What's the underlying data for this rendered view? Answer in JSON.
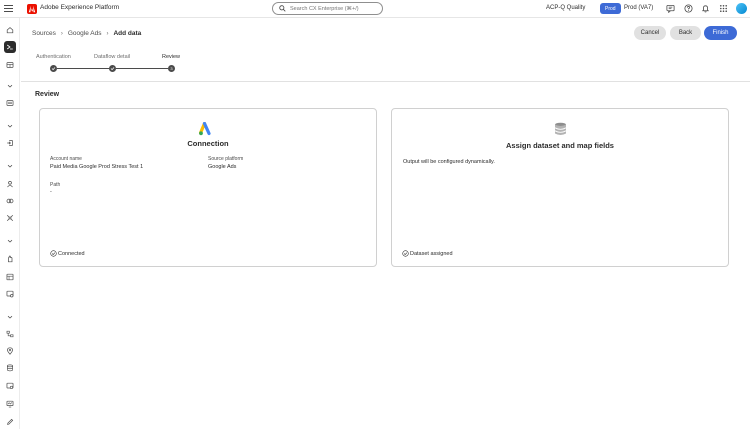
{
  "header": {
    "app_title": "Adobe Experience Platform",
    "search_placeholder": "Search CX Enterprise (⌘+/)",
    "org_name": "ACP-Q Quality",
    "env_badge": "Prod",
    "sandbox_name": "Prod (VA7)",
    "icons": [
      "feedback-icon",
      "help-icon",
      "notifications-icon",
      "app-switcher-icon",
      "avatar"
    ]
  },
  "sidebar": {
    "items": [
      {
        "icon": "home-icon",
        "active": false
      },
      {
        "icon": "sources-icon",
        "active": true
      },
      {
        "icon": "browse-icon",
        "active": false
      },
      {
        "icon": "chevron-down-icon",
        "active": false
      },
      {
        "icon": "dashboard-icon",
        "active": false
      },
      {
        "icon": "chevron-down-icon",
        "active": false
      },
      {
        "icon": "login-icon",
        "active": false
      },
      {
        "icon": "chevron-down-icon",
        "active": false
      },
      {
        "icon": "profile-icon",
        "active": false
      },
      {
        "icon": "audiences-icon",
        "active": false
      },
      {
        "icon": "identities-icon",
        "active": false
      },
      {
        "icon": "chevron-down-icon",
        "active": false
      },
      {
        "icon": "consent-icon",
        "active": false
      },
      {
        "icon": "schemas-icon",
        "active": false
      },
      {
        "icon": "datasets-icon",
        "active": false
      },
      {
        "icon": "chevron-down-icon",
        "active": false
      },
      {
        "icon": "workflows-icon",
        "active": false
      },
      {
        "icon": "destinations-icon",
        "active": false
      },
      {
        "icon": "data-icon",
        "active": false
      },
      {
        "icon": "queries-icon",
        "active": false
      },
      {
        "icon": "monitoring-icon",
        "active": false
      },
      {
        "icon": "edit-icon",
        "active": false
      }
    ]
  },
  "breadcrumb": {
    "items": [
      "Sources",
      "Google Ads"
    ],
    "current": "Add data"
  },
  "actions": {
    "cancel": "Cancel",
    "back": "Back",
    "finish": "Finish"
  },
  "steps": {
    "items": [
      {
        "label": "Authentication",
        "state": "done"
      },
      {
        "label": "Dataflow detail",
        "state": "done"
      },
      {
        "label": "Review",
        "state": "current",
        "number": "3"
      }
    ]
  },
  "review": {
    "title": "Review",
    "connection": {
      "title": "Connection",
      "account_name_label": "Account name",
      "account_name_value": "Paid Media Google Prod Stress Test 1",
      "source_platform_label": "Source platform",
      "source_platform_value": "Google Ads",
      "path_label": "Path",
      "path_value": "-",
      "status": "Connected"
    },
    "dataset": {
      "title": "Assign dataset and map fields",
      "description": "Output will be configured dynamically.",
      "status": "Dataset assigned"
    }
  }
}
